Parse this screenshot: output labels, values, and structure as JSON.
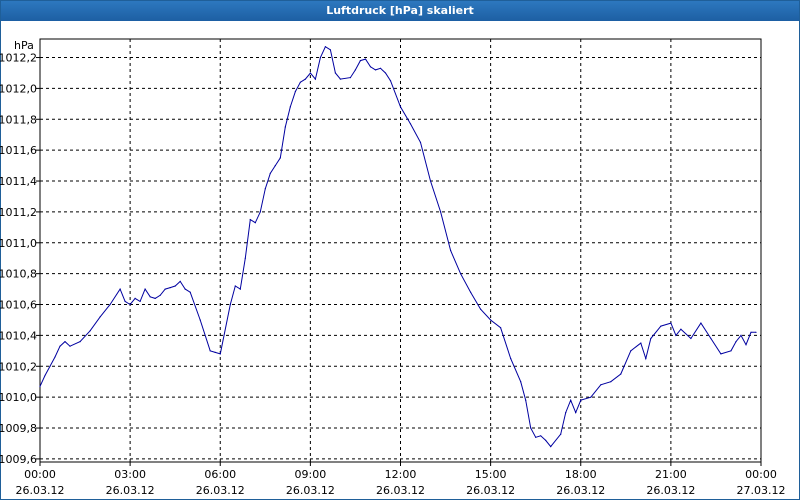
{
  "window": {
    "title": "Luftdruck [hPa] skaliert"
  },
  "colors": {
    "titlebar": "#1d5fa3",
    "line": "#0000a0",
    "grid": "#000000"
  },
  "chart_data": {
    "type": "line",
    "title": "Luftdruck [hPa] skaliert",
    "ylabel": "hPa",
    "xlabel": "",
    "ylim": [
      1009.58,
      1012.32
    ],
    "xlim_hours": [
      0,
      24
    ],
    "grid": true,
    "y_ticks": [
      "1012,2",
      "1012,0",
      "1011,8",
      "1011,6",
      "1011,4",
      "1011,2",
      "1011,0",
      "1010,8",
      "1010,6",
      "1010,4",
      "1010,2",
      "1010,0",
      "1009,8",
      "1009,6"
    ],
    "x_ticks": [
      {
        "time": "00:00",
        "date": "26.03.12"
      },
      {
        "time": "03:00",
        "date": "26.03.12"
      },
      {
        "time": "06:00",
        "date": "26.03.12"
      },
      {
        "time": "09:00",
        "date": "26.03.12"
      },
      {
        "time": "12:00",
        "date": "26.03.12"
      },
      {
        "time": "15:00",
        "date": "26.03.12"
      },
      {
        "time": "18:00",
        "date": "26.03.12"
      },
      {
        "time": "21:00",
        "date": "26.03.12"
      },
      {
        "time": "00:00",
        "date": "27.03.12"
      }
    ],
    "series": [
      {
        "x": [
          "26.03.12 00:00",
          "26.03.12 00:10",
          "26.03.12 00:20",
          "26.03.12 00:30",
          "26.03.12 00:40",
          "26.03.12 00:50",
          "26.03.12 01:00",
          "26.03.12 01:20",
          "26.03.12 01:40",
          "26.03.12 02:00",
          "26.03.12 02:20",
          "26.03.12 02:40",
          "26.03.12 02:50",
          "26.03.12 03:00",
          "26.03.12 03:10",
          "26.03.12 03:20",
          "26.03.12 03:30",
          "26.03.12 03:40",
          "26.03.12 03:50",
          "26.03.12 04:00",
          "26.03.12 04:10",
          "26.03.12 04:20",
          "26.03.12 04:30",
          "26.03.12 04:40",
          "26.03.12 04:50",
          "26.03.12 05:00",
          "26.03.12 05:20",
          "26.03.12 05:40",
          "26.03.12 05:50",
          "26.03.12 06:00",
          "26.03.12 06:20",
          "26.03.12 06:30",
          "26.03.12 06:40",
          "26.03.12 06:50",
          "26.03.12 07:00",
          "26.03.12 07:10",
          "26.03.12 07:20",
          "26.03.12 07:30",
          "26.03.12 07:40",
          "26.03.12 07:50",
          "26.03.12 08:00",
          "26.03.12 08:10",
          "26.03.12 08:20",
          "26.03.12 08:30",
          "26.03.12 08:40",
          "26.03.12 08:50",
          "26.03.12 09:00",
          "26.03.12 09:10",
          "26.03.12 09:20",
          "26.03.12 09:30",
          "26.03.12 09:40",
          "26.03.12 09:50",
          "26.03.12 10:00",
          "26.03.12 10:20",
          "26.03.12 10:30",
          "26.03.12 10:40",
          "26.03.12 10:50",
          "26.03.12 11:00",
          "26.03.12 11:10",
          "26.03.12 11:20",
          "26.03.12 11:30",
          "26.03.12 11:40",
          "26.03.12 12:00",
          "26.03.12 12:20",
          "26.03.12 12:40",
          "26.03.12 13:00",
          "26.03.12 13:20",
          "26.03.12 13:40",
          "26.03.12 14:00",
          "26.03.12 14:20",
          "26.03.12 14:40",
          "26.03.12 15:00",
          "26.03.12 15:20",
          "26.03.12 15:40",
          "26.03.12 16:00",
          "26.03.12 16:10",
          "26.03.12 16:20",
          "26.03.12 16:30",
          "26.03.12 16:40",
          "26.03.12 16:50",
          "26.03.12 17:00",
          "26.03.12 17:20",
          "26.03.12 17:30",
          "26.03.12 17:40",
          "26.03.12 17:50",
          "26.03.12 18:00",
          "26.03.12 18:20",
          "26.03.12 18:40",
          "26.03.12 19:00",
          "26.03.12 19:20",
          "26.03.12 19:40",
          "26.03.12 20:00",
          "26.03.12 20:10",
          "26.03.12 20:20",
          "26.03.12 20:40",
          "26.03.12 21:00",
          "26.03.12 21:10",
          "26.03.12 21:20",
          "26.03.12 21:40",
          "26.03.12 22:00",
          "26.03.12 22:20",
          "26.03.12 22:40",
          "26.03.12 23:00",
          "26.03.12 23:10",
          "26.03.12 23:20",
          "26.03.12 23:30",
          "26.03.12 23:40",
          "26.03.12 23:50"
        ],
        "values": [
          1010.07,
          1010.14,
          1010.2,
          1010.26,
          1010.33,
          1010.36,
          1010.33,
          1010.36,
          1010.43,
          1010.52,
          1010.6,
          1010.7,
          1010.62,
          1010.6,
          1010.64,
          1010.62,
          1010.7,
          1010.65,
          1010.64,
          1010.66,
          1010.7,
          1010.71,
          1010.72,
          1010.75,
          1010.7,
          1010.68,
          1010.5,
          1010.3,
          1010.29,
          1010.28,
          1010.6,
          1010.72,
          1010.7,
          1010.9,
          1011.15,
          1011.13,
          1011.2,
          1011.35,
          1011.45,
          1011.5,
          1011.55,
          1011.75,
          1011.88,
          1011.98,
          1012.04,
          1012.06,
          1012.1,
          1012.06,
          1012.2,
          1012.27,
          1012.25,
          1012.1,
          1012.06,
          1012.07,
          1012.12,
          1012.18,
          1012.19,
          1012.14,
          1012.12,
          1012.13,
          1012.1,
          1012.05,
          1011.88,
          1011.77,
          1011.65,
          1011.4,
          1011.2,
          1010.95,
          1010.8,
          1010.68,
          1010.57,
          1010.5,
          1010.45,
          1010.25,
          1010.1,
          1009.98,
          1009.8,
          1009.74,
          1009.75,
          1009.72,
          1009.68,
          1009.76,
          1009.9,
          1009.98,
          1009.9,
          1009.98,
          1010.0,
          1010.08,
          1010.1,
          1010.15,
          1010.3,
          1010.35,
          1010.25,
          1010.38,
          1010.46,
          1010.48,
          1010.4,
          1010.44,
          1010.38,
          1010.48,
          1010.38,
          1010.28,
          1010.3,
          1010.36,
          1010.4,
          1010.34,
          1010.42,
          1010.42
        ]
      }
    ]
  }
}
